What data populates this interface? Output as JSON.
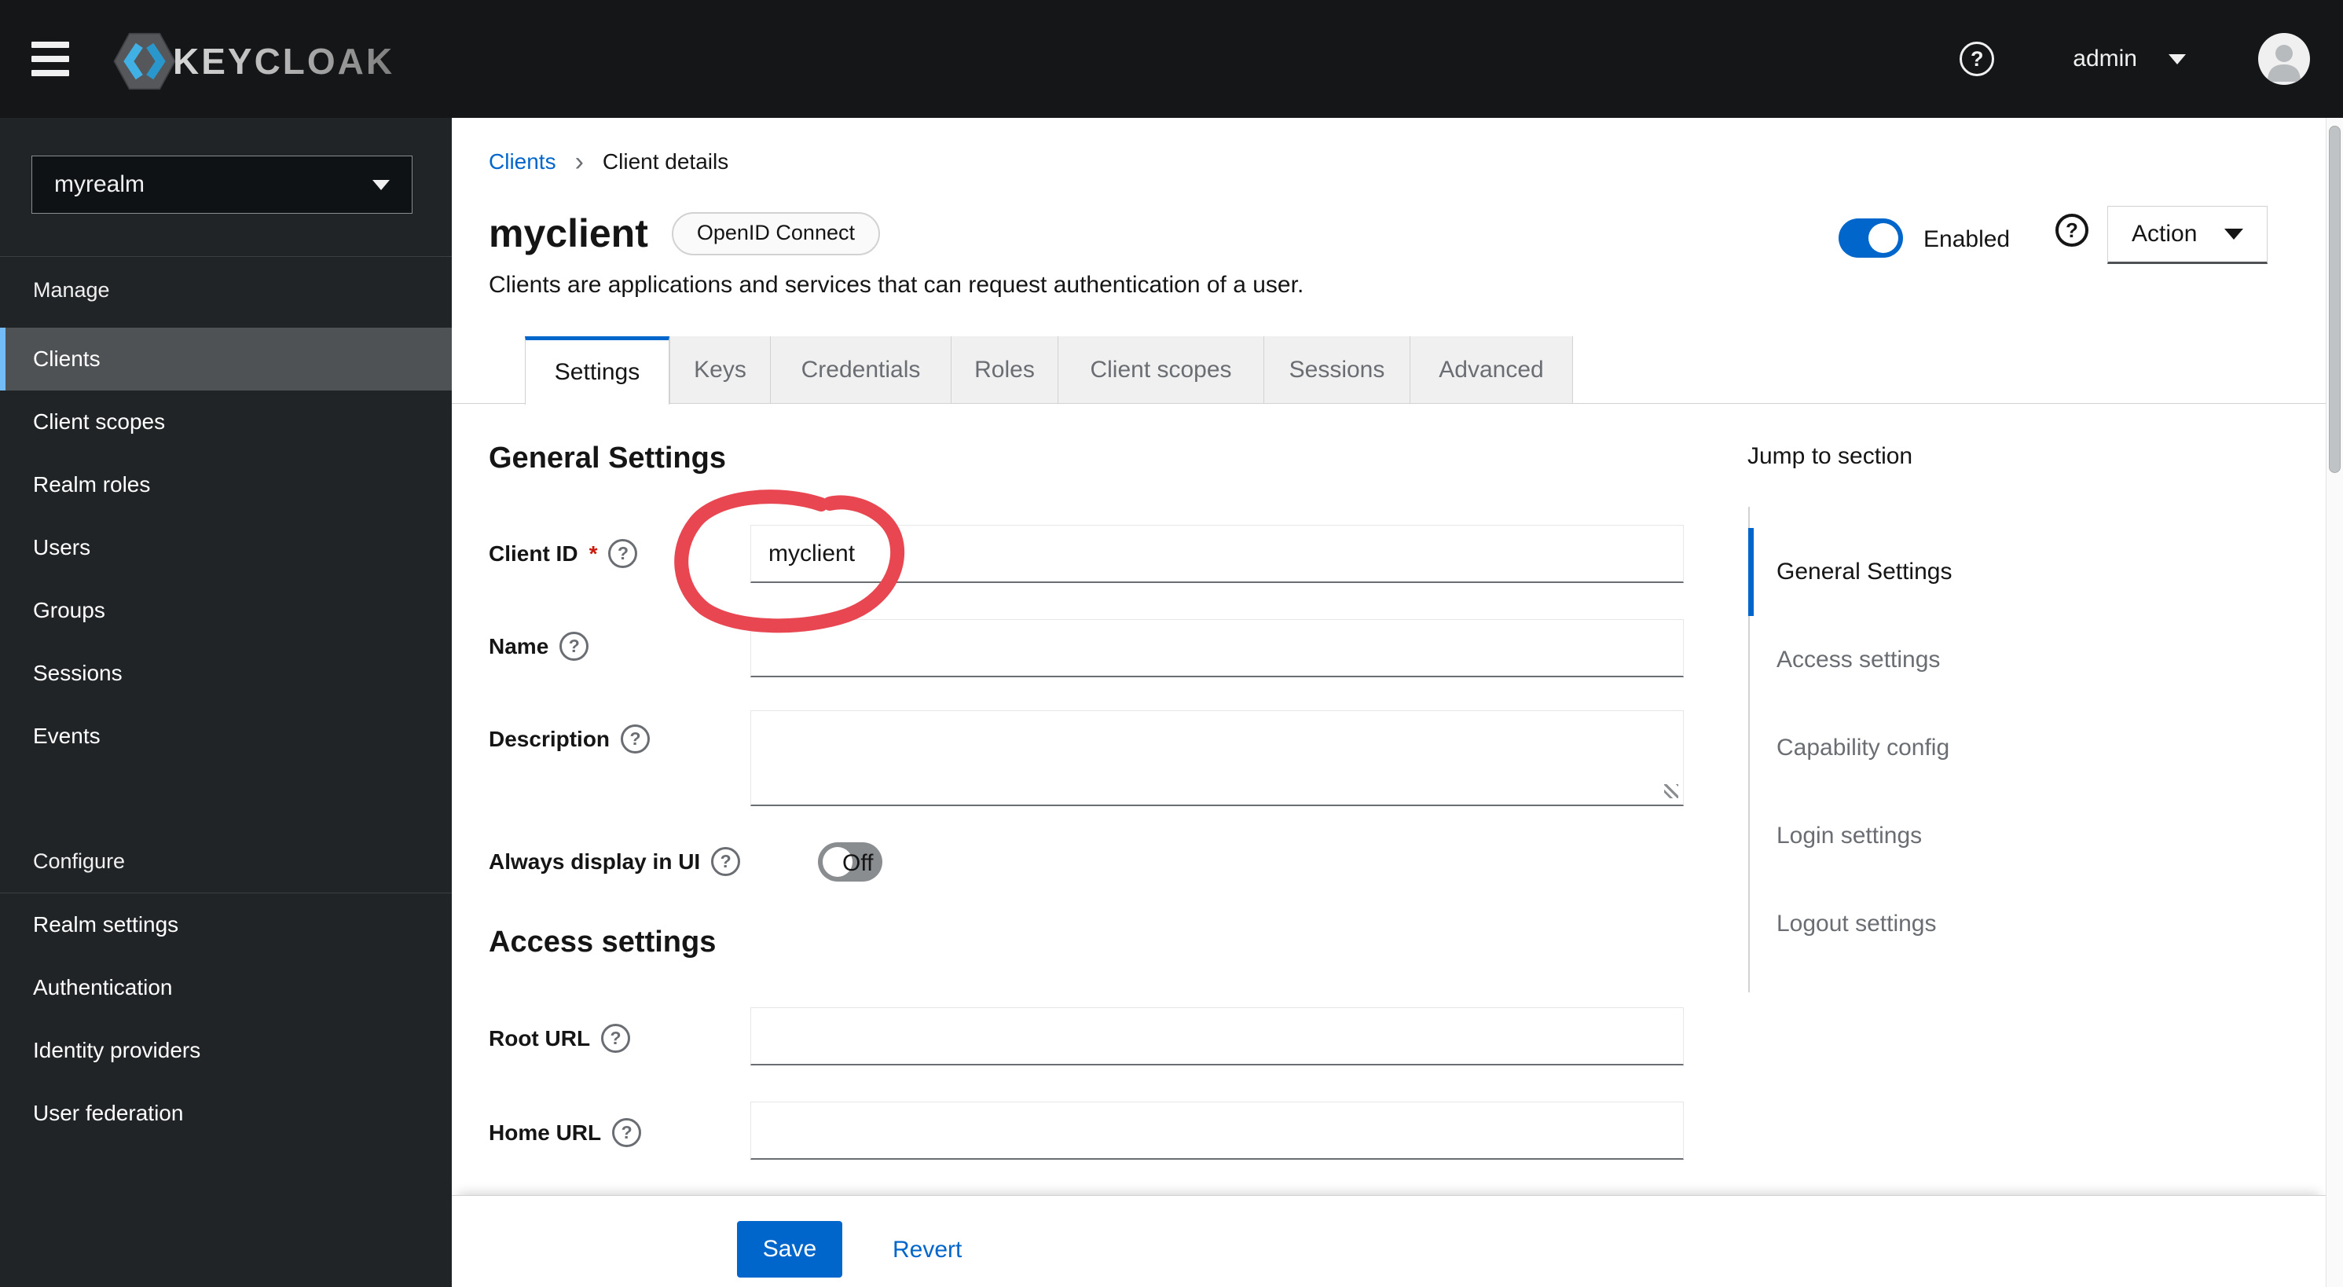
{
  "masthead": {
    "logo_text": "KEYCLOAK",
    "username": "admin"
  },
  "sidebar": {
    "realm": "myrealm",
    "sections": [
      {
        "title": "Manage",
        "items": [
          "Clients",
          "Client scopes",
          "Realm roles",
          "Users",
          "Groups",
          "Sessions",
          "Events"
        ],
        "active": "Clients"
      },
      {
        "title": "Configure",
        "items": [
          "Realm settings",
          "Authentication",
          "Identity providers",
          "User federation"
        ]
      }
    ]
  },
  "breadcrumb": {
    "parent": "Clients",
    "current": "Client details"
  },
  "header": {
    "title": "myclient",
    "badge": "OpenID Connect",
    "description": "Clients are applications and services that can request authentication of a user.",
    "enabled_label": "Enabled",
    "action_label": "Action"
  },
  "tabs": {
    "active": "Settings",
    "items": [
      "Settings",
      "Keys",
      "Credentials",
      "Roles",
      "Client scopes",
      "Sessions",
      "Advanced"
    ]
  },
  "form": {
    "section_general": "General Settings",
    "client_id": {
      "label": "Client ID",
      "required": true,
      "value": "myclient"
    },
    "name": {
      "label": "Name",
      "value": ""
    },
    "description": {
      "label": "Description",
      "value": ""
    },
    "always_display": {
      "label": "Always display in UI",
      "state": "Off"
    },
    "section_access": "Access settings",
    "root_url": {
      "label": "Root URL",
      "value": ""
    },
    "home_url": {
      "label": "Home URL",
      "value": ""
    }
  },
  "jump": {
    "title": "Jump to section",
    "items": [
      "General Settings",
      "Access settings",
      "Capability config",
      "Login settings",
      "Logout settings"
    ],
    "active": "General Settings"
  },
  "footer": {
    "save": "Save",
    "revert": "Revert"
  },
  "colors": {
    "primary": "#0066cc",
    "nav_active_bar": "#73bcf7",
    "annotation": "#e84752",
    "masthead_bg": "#141618",
    "sidebar_bg": "#212427"
  }
}
